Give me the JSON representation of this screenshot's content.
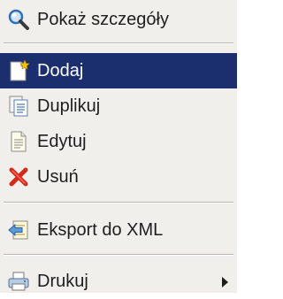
{
  "menu": {
    "items": [
      {
        "label": "Pokaż szczegóły",
        "icon": "magnifier-icon"
      },
      {
        "label": "Dodaj",
        "icon": "new-document-icon"
      },
      {
        "label": "Duplikuj",
        "icon": "duplicate-document-icon"
      },
      {
        "label": "Edytuj",
        "icon": "edit-document-icon"
      },
      {
        "label": "Usuń",
        "icon": "delete-x-icon"
      },
      {
        "label": "Eksport do XML",
        "icon": "export-arrow-icon"
      },
      {
        "label": "Drukuj",
        "icon": "printer-icon"
      }
    ],
    "selected_index": 1,
    "colors": {
      "background": "#f1efec",
      "selection": "#1b2f6e",
      "text": "#1e1e1e",
      "selected_text": "#ffffff"
    }
  }
}
